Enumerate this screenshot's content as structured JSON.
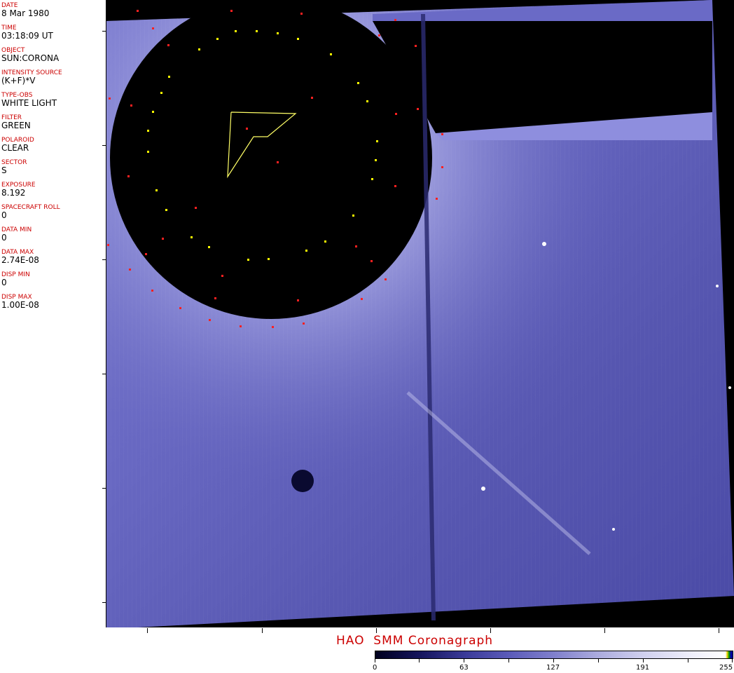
{
  "metadata": [
    {
      "label": "DATE",
      "value": "8 Mar 1980"
    },
    {
      "label": "TIME",
      "value": "03:18:09 UT"
    },
    {
      "label": "OBJECT",
      "value": "SUN:CORONA"
    },
    {
      "label": "INTENSITY SOURCE",
      "value": "(K+F)*V"
    },
    {
      "label": "TYPE-OBS",
      "value": "WHITE LIGHT"
    },
    {
      "label": "FILTER",
      "value": "GREEN"
    },
    {
      "label": "POLAROID",
      "value": "CLEAR"
    },
    {
      "label": "SECTOR",
      "value": "S"
    },
    {
      "label": "EXPOSURE",
      "value": "8.192"
    },
    {
      "label": "SPACECRAFT ROLL",
      "value": "0"
    },
    {
      "label": "DATA MIN",
      "value": "0"
    },
    {
      "label": "DATA MAX",
      "value": "2.74E-08"
    },
    {
      "label": "DISP MIN",
      "value": "0"
    },
    {
      "label": "DISP MAX",
      "value": "1.00E-08"
    }
  ],
  "caption": "HAO  SMM Coronagraph",
  "colorbar": {
    "labels": [
      "0",
      "63",
      "127",
      "191",
      "255"
    ],
    "colors": {
      "low": "#00001e",
      "mid": "#8080cc",
      "high": "#ffffff"
    }
  },
  "colors": {
    "label_red": "#cc0000",
    "corona_blue": "#5a5ab8",
    "occulter": "#000000",
    "marker_yellow": "#ffff00",
    "marker_red": "#ff0000"
  }
}
